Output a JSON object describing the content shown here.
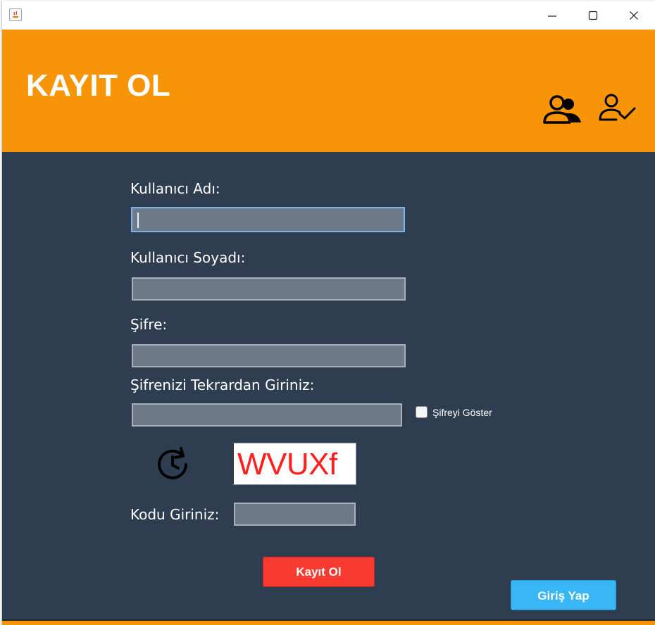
{
  "window": {
    "controls": [
      "minimize-icon",
      "maximize-icon",
      "close-icon"
    ]
  },
  "header": {
    "title": "KAYIT OL",
    "icons": [
      "users-icon",
      "user-check-icon"
    ],
    "background": "#f79407"
  },
  "form": {
    "first_name_label": "Kullanıcı Adı:",
    "first_name_value": "",
    "last_name_label": "Kullanıcı Soyadı:",
    "last_name_value": "",
    "password_label": "Şifre:",
    "password_value": "",
    "password_repeat_label": "Şifrenizi Tekrardan Giriniz:",
    "password_repeat_value": "",
    "show_password_label": "Şifreyi Göster",
    "show_password_checked": false,
    "captcha_text": "WVUXf",
    "captcha_refresh_icon": "refresh-clock-icon",
    "code_label": "Kodu Giriniz:",
    "code_value": ""
  },
  "actions": {
    "register_label": "Kayıt Ol",
    "login_label": "Giriş Yap"
  },
  "colors": {
    "panel": "#2e3d4f",
    "field": "#6d7a89",
    "register_button": "#f73b30",
    "login_button": "#38b6f5",
    "captcha_text": "#ff1f1f"
  }
}
